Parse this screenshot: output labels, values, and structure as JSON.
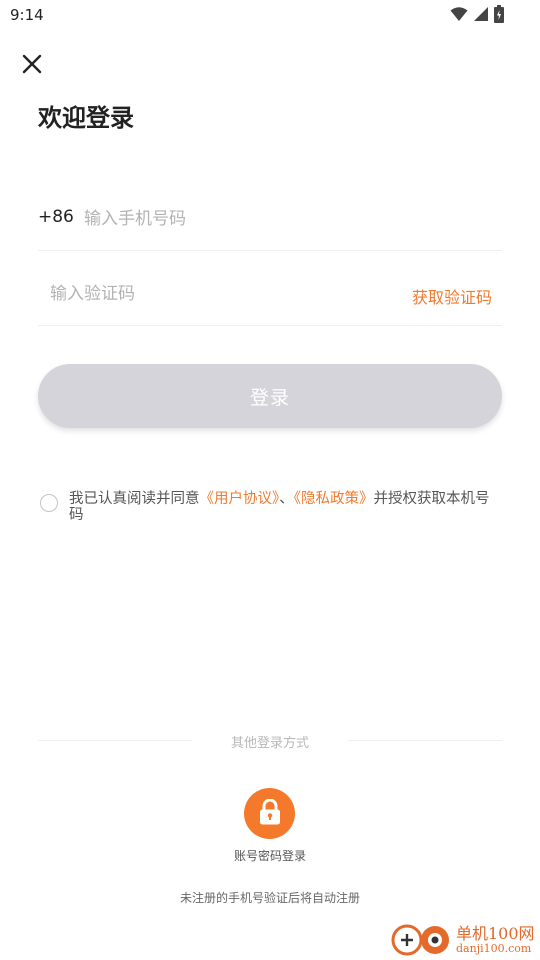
{
  "status_bar": {
    "time": "9:14"
  },
  "header": {
    "title": "欢迎登录"
  },
  "phone": {
    "country_code": "+86",
    "placeholder": "输入手机号码"
  },
  "code": {
    "placeholder": "输入验证码",
    "get_code_label": "获取验证码"
  },
  "login_button": {
    "label": "登录"
  },
  "agreement": {
    "prefix": "我已认真阅读并同意",
    "user_agreement": "《用户协议》",
    "separator": "、",
    "privacy_policy": "《隐私政策》",
    "suffix": "并授权获取本机号码",
    "checked": false
  },
  "other_login": {
    "title": "其他登录方式",
    "password_login_label": "账号密码登录"
  },
  "footer_note": "未注册的手机号验证后将自动注册",
  "watermark": {
    "line1": "单机100网",
    "line2": "danji100.com"
  },
  "colors": {
    "accent": "#f07a2f",
    "button_disabled": "#d5d4da",
    "icon_bg": "#f5792b"
  }
}
